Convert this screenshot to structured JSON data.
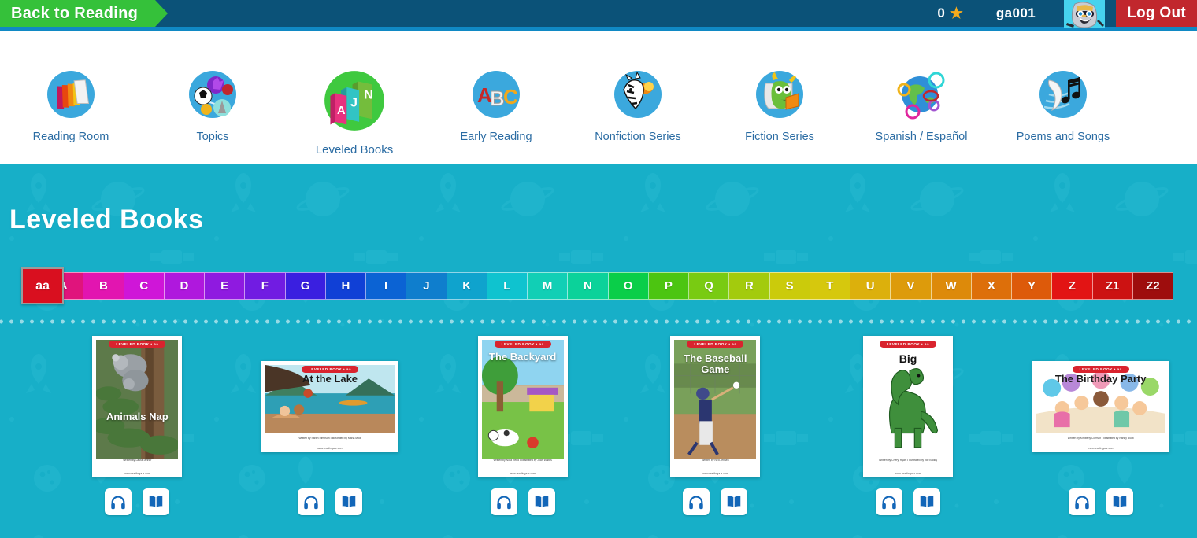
{
  "header": {
    "back_label": "Back to Reading",
    "star_count": "0",
    "star_icon": "star-icon",
    "username": "ga001",
    "avatar_icon": "knight-avatar-icon",
    "logout_label": "Log Out"
  },
  "nav": {
    "items": [
      {
        "label": "Reading Room",
        "icon": "books-stack-icon",
        "active": false
      },
      {
        "label": "Topics",
        "icon": "topics-network-icon",
        "active": false
      },
      {
        "label": "Leveled Books",
        "icon": "leveled-books-icon",
        "active": true
      },
      {
        "label": "Early Reading",
        "icon": "abc-blocks-icon",
        "active": false
      },
      {
        "label": "Nonfiction Series",
        "icon": "zebra-icon",
        "active": false
      },
      {
        "label": "Fiction Series",
        "icon": "dragon-reading-icon",
        "active": false
      },
      {
        "label": "Spanish / Español",
        "icon": "globe-icon",
        "active": false
      },
      {
        "label": "Poems and Songs",
        "icon": "quill-music-icon",
        "active": false
      }
    ]
  },
  "main": {
    "page_title": "Leveled Books",
    "levels": [
      {
        "label": "aa",
        "color": "#d90f1f",
        "selected": true
      },
      {
        "label": "A",
        "color": "#e0147c",
        "selected": false
      },
      {
        "label": "B",
        "color": "#e215b0",
        "selected": false
      },
      {
        "label": "C",
        "color": "#cf16d8",
        "selected": false
      },
      {
        "label": "D",
        "color": "#af18dd",
        "selected": false
      },
      {
        "label": "E",
        "color": "#8f1ae0",
        "selected": false
      },
      {
        "label": "F",
        "color": "#711ce2",
        "selected": false
      },
      {
        "label": "G",
        "color": "#3a1fe0",
        "selected": false
      },
      {
        "label": "H",
        "color": "#1040d6",
        "selected": false
      },
      {
        "label": "I",
        "color": "#0b63d4",
        "selected": false
      },
      {
        "label": "J",
        "color": "#0f7ecd",
        "selected": false
      },
      {
        "label": "K",
        "color": "#0fa3cd",
        "selected": false
      },
      {
        "label": "L",
        "color": "#0fc3cf",
        "selected": false
      },
      {
        "label": "M",
        "color": "#11cfb5",
        "selected": false
      },
      {
        "label": "N",
        "color": "#0bd29a",
        "selected": false
      },
      {
        "label": "O",
        "color": "#0ace49",
        "selected": false
      },
      {
        "label": "P",
        "color": "#4cc511",
        "selected": false
      },
      {
        "label": "Q",
        "color": "#79cb12",
        "selected": false
      },
      {
        "label": "R",
        "color": "#a3cb0d",
        "selected": false
      },
      {
        "label": "S",
        "color": "#cbcb0b",
        "selected": false
      },
      {
        "label": "T",
        "color": "#d6c80d",
        "selected": false
      },
      {
        "label": "U",
        "color": "#dcb00c",
        "selected": false
      },
      {
        "label": "V",
        "color": "#dd9b0b",
        "selected": false
      },
      {
        "label": "W",
        "color": "#dd8a0a",
        "selected": false
      },
      {
        "label": "X",
        "color": "#dd6f0a",
        "selected": false
      },
      {
        "label": "Y",
        "color": "#dd5a0a",
        "selected": false
      },
      {
        "label": "Z",
        "color": "#e21414",
        "selected": false
      },
      {
        "label": "Z1",
        "color": "#cc1212",
        "selected": false
      },
      {
        "label": "Z2",
        "color": "#9e0d0d",
        "selected": false
      }
    ],
    "books": [
      {
        "title": "Animals Nap",
        "orientation": "portrait",
        "level_banner": "LEVELED BOOK • aa",
        "credit": "Written by Laura Tanner",
        "url": "www.readinga-z.com",
        "listen_label": "Listen",
        "read_label": "Read"
      },
      {
        "title": "At the Lake",
        "orientation": "landscape",
        "level_banner": "LEVELED BOOK • aa",
        "credit": "Written by Sarah Simpson • Illustrated by Maria Mola",
        "url": "www.readinga-z.com",
        "listen_label": "Listen",
        "read_label": "Read"
      },
      {
        "title": "The Backyard",
        "orientation": "portrait",
        "level_banner": "LEVELED BOOK • aa",
        "credit": "Written by Nora Reed • Illustrated by Joan Waites",
        "url": "www.readinga-z.com",
        "listen_label": "Listen",
        "read_label": "Read"
      },
      {
        "title": "The Baseball Game",
        "orientation": "portrait",
        "level_banner": "LEVELED BOOK • aa",
        "credit": "Written by Ned Jensen",
        "url": "www.readinga-z.com",
        "listen_label": "Listen",
        "read_label": "Read"
      },
      {
        "title": "Big",
        "orientation": "portrait",
        "level_banner": "LEVELED BOOK • aa",
        "credit": "Written by Cheryl Ryan • Illustrated by Joe Boddy",
        "url": "www.readinga-z.com",
        "listen_label": "Listen",
        "read_label": "Read"
      },
      {
        "title": "The Birthday Party",
        "orientation": "landscape",
        "level_banner": "LEVELED BOOK • aa",
        "credit": "Written by Kimberly Corman • Illustrated by Nancy Blunt",
        "url": "www.readinga-z.com",
        "listen_label": "Listen",
        "read_label": "Read"
      }
    ]
  },
  "colors": {
    "header_bg": "#0b5278",
    "back_green": "#35c13a",
    "logout_red": "#c1272d",
    "body_teal": "#17afc8",
    "nav_link": "#2b6ca3",
    "star_gold": "#f5ab1d"
  }
}
